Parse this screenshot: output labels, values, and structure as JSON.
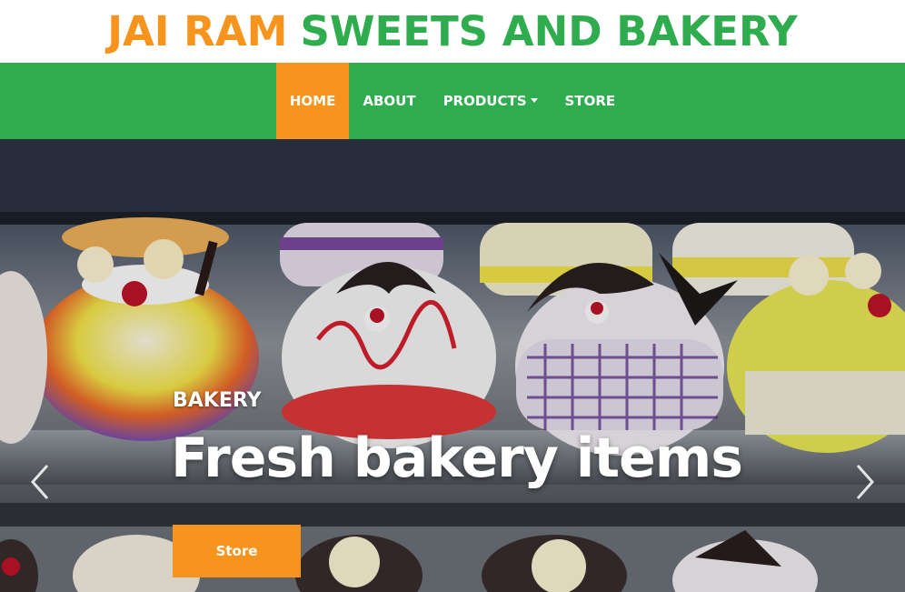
{
  "brand": {
    "part1": "JAI RAM",
    "part2": "SWEETS AND BAKERY"
  },
  "nav": {
    "items": [
      {
        "label": "HOME",
        "active": true
      },
      {
        "label": "ABOUT"
      },
      {
        "label": "PRODUCTS",
        "dropdown": true
      },
      {
        "label": "STORE"
      }
    ]
  },
  "carousel": {
    "subtitle": "BAKERY",
    "title": "Fresh bakery items",
    "button_label": "Store",
    "prev_icon": "chevron-left-icon",
    "next_icon": "chevron-right-icon"
  },
  "colors": {
    "orange": "#f7941d",
    "green": "#2fac4e",
    "white": "#ffffff"
  }
}
